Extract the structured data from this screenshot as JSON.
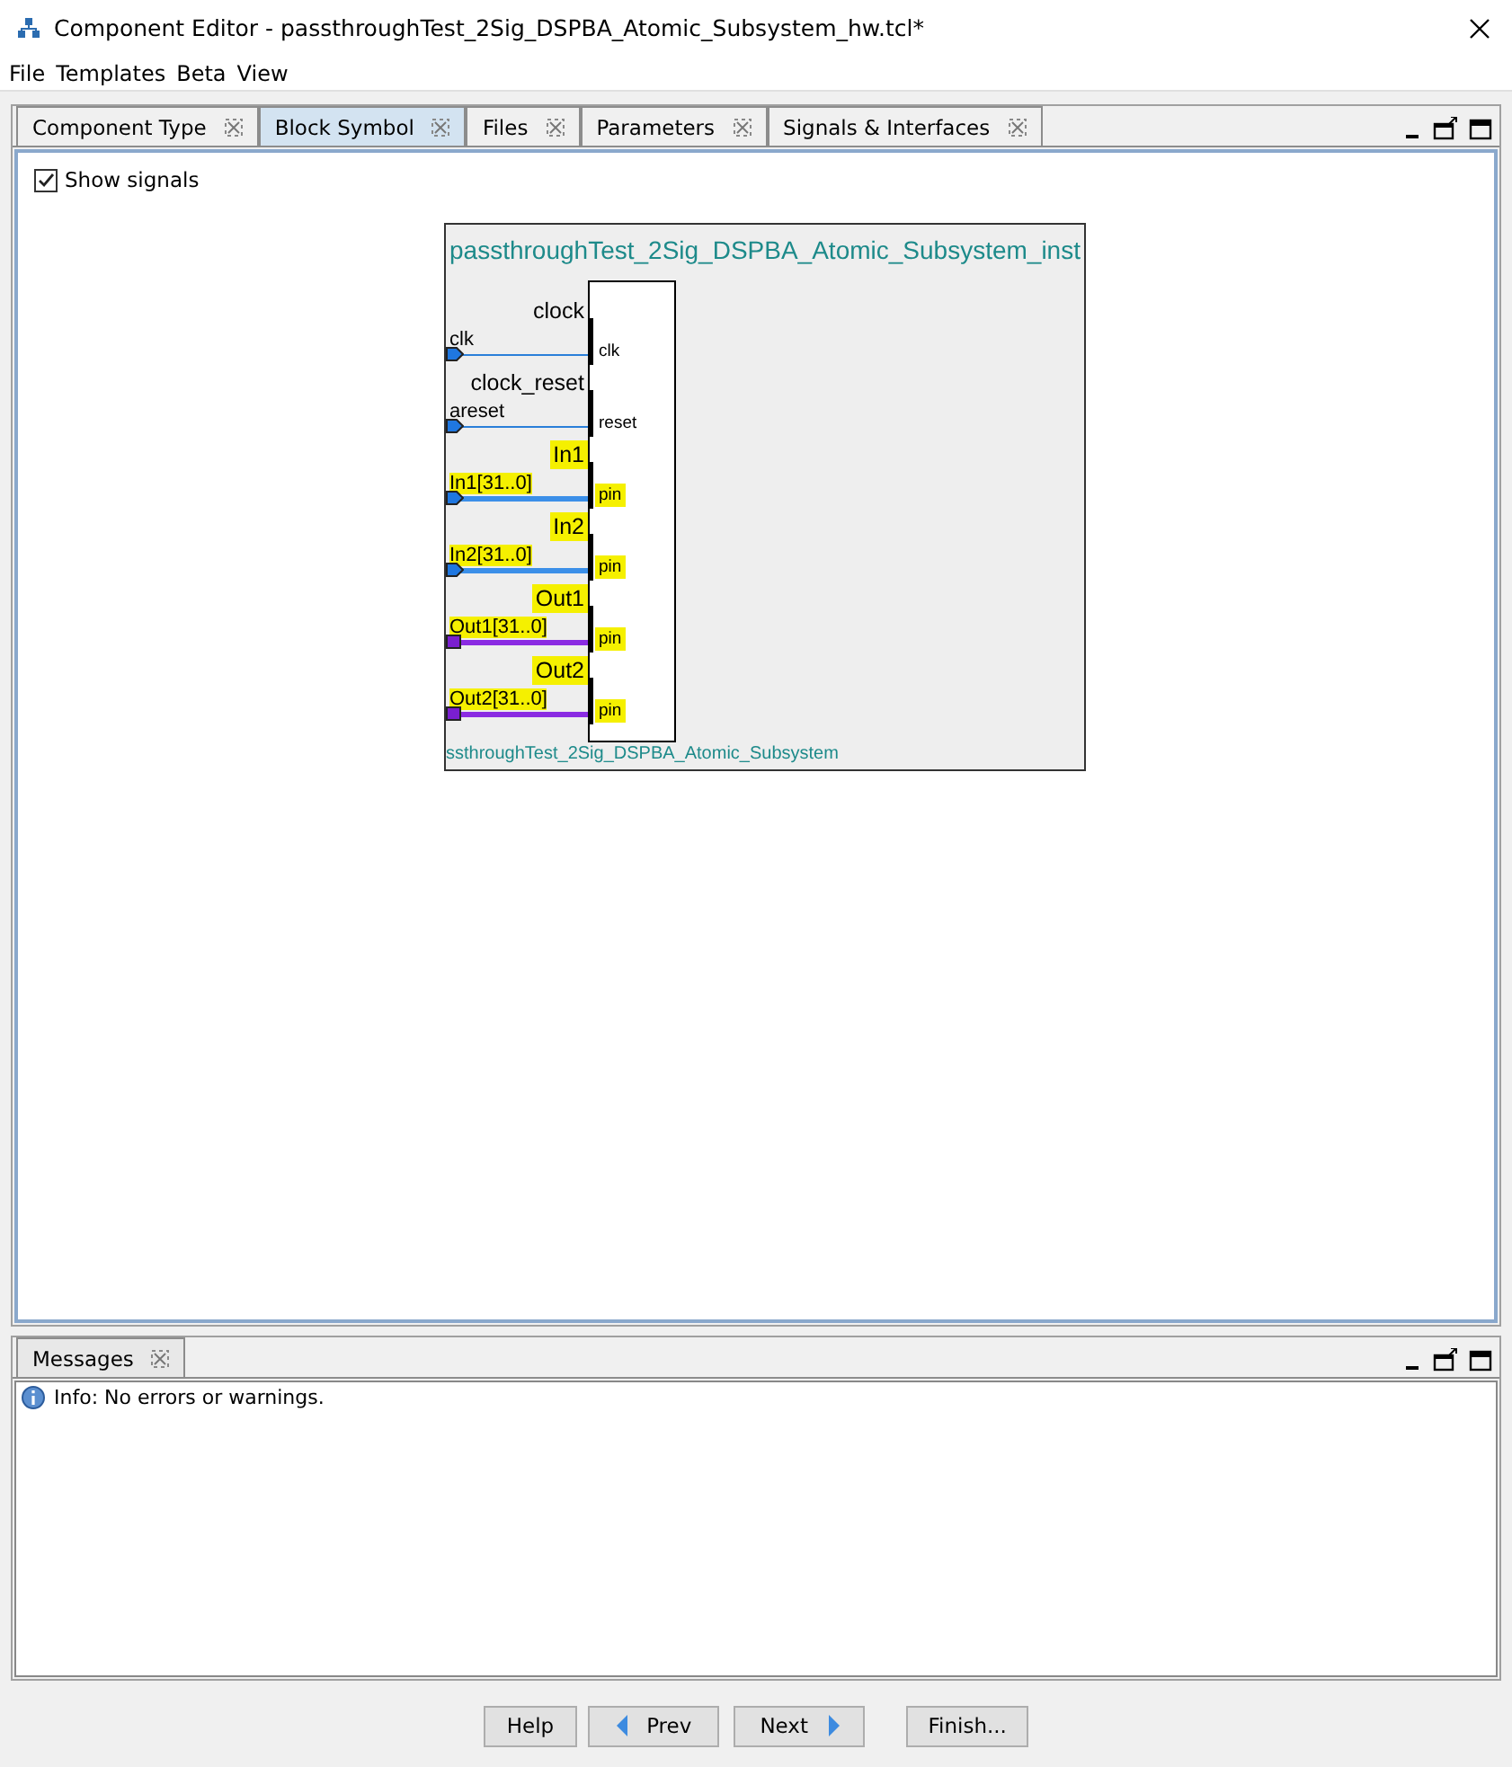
{
  "window": {
    "title": "Component Editor - passthroughTest_2Sig_DSPBA_Atomic_Subsystem_hw.tcl*"
  },
  "menu": [
    "File",
    "Templates",
    "Beta",
    "View"
  ],
  "tabs": [
    {
      "label": "Component Type",
      "selected": false
    },
    {
      "label": "Block Symbol",
      "selected": true
    },
    {
      "label": "Files",
      "selected": false
    },
    {
      "label": "Parameters",
      "selected": false
    },
    {
      "label": "Signals & Interfaces",
      "selected": false
    }
  ],
  "show_signals": {
    "label": "Show signals",
    "checked": true
  },
  "symbol": {
    "instance_name": "passthroughTest_2Sig_DSPBA_Atomic_Subsystem_inst",
    "module_name": "ssthroughTest_2Sig_DSPBA_Atomic_Subsystem",
    "interfaces": [
      {
        "name": "clock",
        "signal": "clk",
        "port": "clk",
        "kind": "clock",
        "highlighted": false
      },
      {
        "name": "clock_reset",
        "signal": "areset",
        "port": "reset",
        "kind": "clock",
        "highlighted": false
      },
      {
        "name": "In1",
        "signal": "In1[31..0]",
        "port": "pin",
        "kind": "input",
        "highlighted": true
      },
      {
        "name": "In2",
        "signal": "In2[31..0]",
        "port": "pin",
        "kind": "input",
        "highlighted": true
      },
      {
        "name": "Out1",
        "signal": "Out1[31..0]",
        "port": "pin",
        "kind": "output",
        "highlighted": true
      },
      {
        "name": "Out2",
        "signal": "Out2[31..0]",
        "port": "pin",
        "kind": "output",
        "highlighted": true
      }
    ]
  },
  "messages": {
    "tab": "Messages",
    "items": [
      {
        "kind": "info",
        "text": "Info: No errors or warnings."
      }
    ]
  },
  "buttons": [
    {
      "label": "Help",
      "kind": "plain"
    },
    {
      "label": "Prev",
      "kind": "prev"
    },
    {
      "label": "Next",
      "kind": "next"
    },
    {
      "label": "Finish...",
      "kind": "plain"
    }
  ]
}
